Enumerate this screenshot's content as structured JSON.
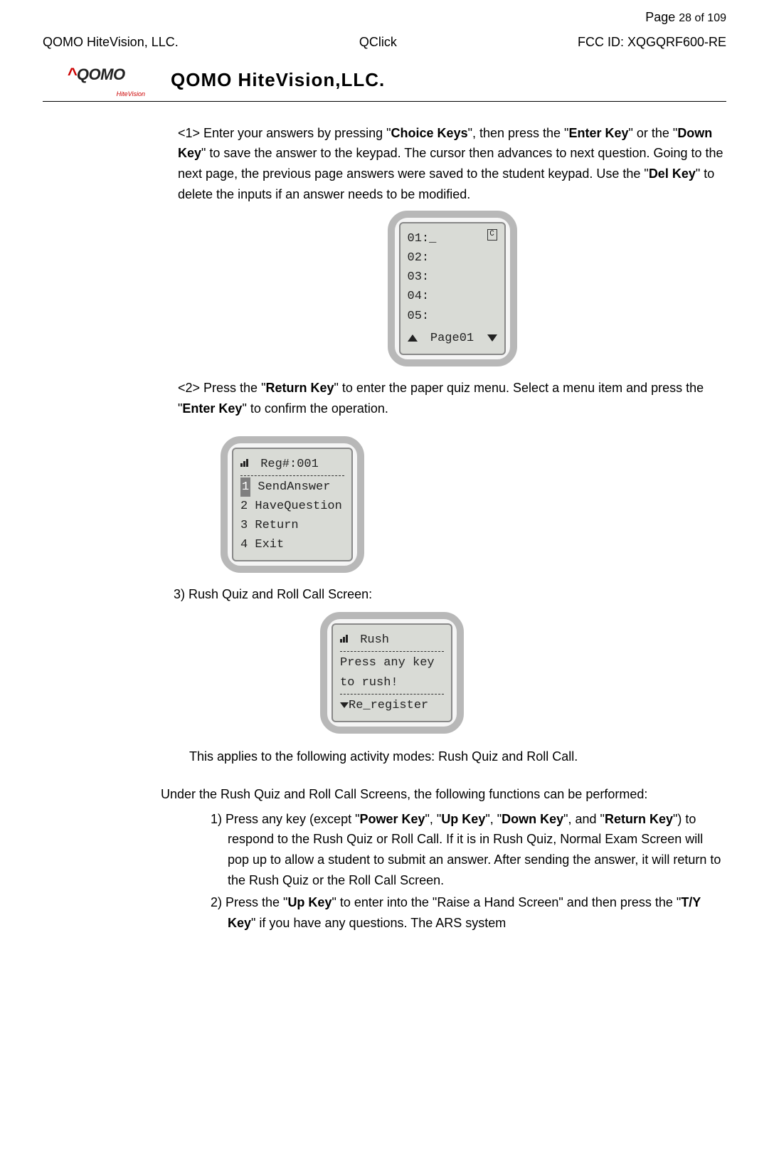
{
  "header": {
    "page_label_prefix": "Page ",
    "page_num": "28",
    "page_of": " of 109",
    "left": "QOMO HiteVision, LLC.",
    "center": "QClick",
    "right": "FCC ID: XQGQRF600-RE",
    "logo_main": "QOMO",
    "logo_sub": "HiteVision",
    "brand_title": "QOMO HiteVision,LLC."
  },
  "body": {
    "p1_a": "<1> Enter your answers by pressing \"",
    "p1_b_bold": "Choice Keys",
    "p1_c": "\", then press the \"",
    "p1_d_bold": "Enter Key",
    "p1_e": "\" or the \"",
    "p1_f_bold": "Down Key",
    "p1_g": "\" to save the answer to the keypad. The cursor then advances to next question. Going to the next page, the previous page answers were saved to the student keypad. Use the \"",
    "p1_h_bold": "Del Key",
    "p1_i": "\" to delete the inputs if an answer needs to be modified.",
    "device1": {
      "l1": "01:_",
      "c_label": "C",
      "l2": "02:",
      "l3": "03:",
      "l4": "04:",
      "l5": "05:",
      "footer": "Page01"
    },
    "p2_a": "<2> Press the \"",
    "p2_b_bold": "Return Key",
    "p2_c": "\" to enter the paper quiz menu. Select a menu item and press the \"",
    "p2_d_bold": "Enter Key",
    "p2_e": "\" to confirm the operation.",
    "device2": {
      "header": " Reg#:001",
      "l1_num": "1",
      "l1_txt": " SendAnswer",
      "l2": "2 HaveQuestion",
      "l3": "3 Return",
      "l4": "4 Exit"
    },
    "item3": "3)   Rush Quiz and Roll Call Screen:",
    "device3": {
      "header": "    Rush",
      "l1": "Press any key",
      "l2": "to rush!",
      "footer": "Re_register"
    },
    "p4": "This applies to the following activity modes: Rush Quiz and Roll Call.",
    "p5": "Under the Rush Quiz and Roll Call Screens, the following functions can be performed:",
    "f1_a": "1) Press any key (except \"",
    "f1_b_bold": "Power Key",
    "f1_c": "\", \"",
    "f1_d_bold": "Up Key",
    "f1_e": "\", \"",
    "f1_f_bold": "Down Key",
    "f1_g": "\", and \"",
    "f1_h_bold": "Return Key",
    "f1_i": "\") to respond to the Rush Quiz or Roll Call. If it is in Rush Quiz, Normal Exam Screen will pop up to allow a student to submit an answer. After sending the answer, it will return to the Rush Quiz or the Roll Call Screen.",
    "f2_a": "2) Press the \"",
    "f2_b_bold": "Up Key",
    "f2_c": "\" to enter into the \"Raise a Hand Screen\" and then press the \"",
    "f2_d_bold": "T/Y Key",
    "f2_e": "\" if you have any questions. The ARS system"
  }
}
